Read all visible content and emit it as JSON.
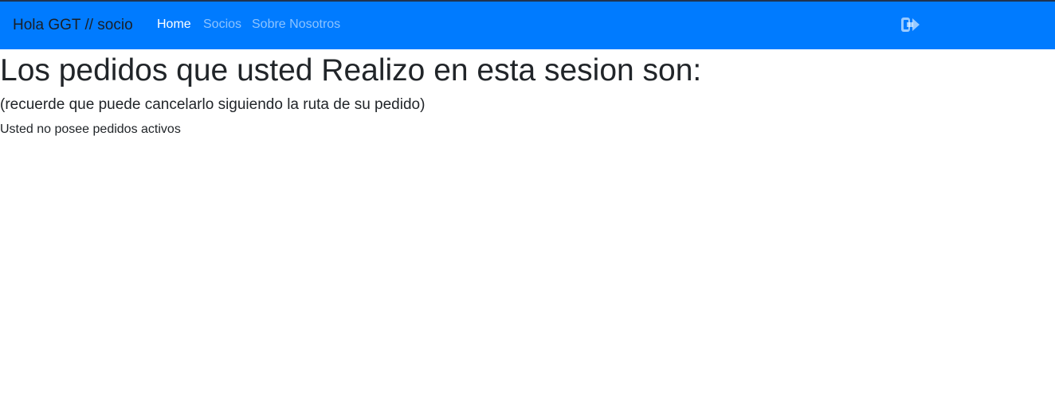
{
  "navbar": {
    "brand": "Hola GGT // socio",
    "links": [
      {
        "label": "Home",
        "active": true
      },
      {
        "label": "Socios",
        "active": false
      },
      {
        "label": "Sobre Nosotros",
        "active": false
      }
    ],
    "logout_icon": "sign-out-icon",
    "background_color": "#007bff"
  },
  "main": {
    "title": "Los pedidos que usted Realizo en esta sesion son:",
    "subtitle": "(recuerde que puede cancelarlo siguiendo la ruta de su pedido)",
    "empty_message": "Usted no posee pedidos activos"
  }
}
